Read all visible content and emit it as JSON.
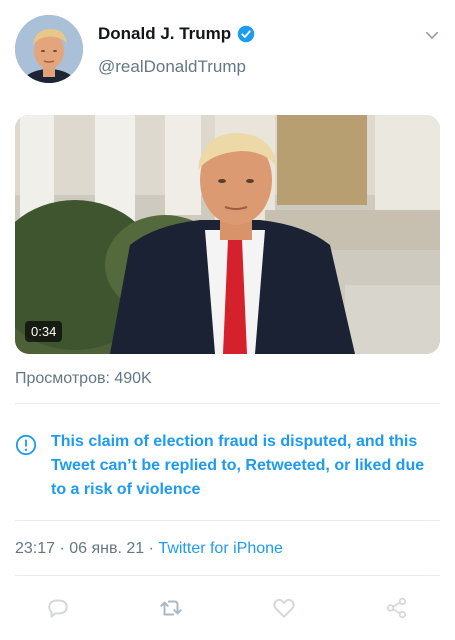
{
  "tweet": {
    "author_name": "Donald J. Trump",
    "author_handle": "@realDonaldTrump",
    "verified": true,
    "video_duration": "0:34",
    "views_text": "Просмотров: 490K",
    "notice_text": "This claim of election fraud is disputed, and this Tweet can’t be replied to, Retweeted, or liked due to a risk of violence",
    "time": "23:17",
    "separator": " · ",
    "date": "06 янв. 21",
    "source": "Twitter for iPhone"
  },
  "icons": {
    "verified": "verified-badge-icon",
    "menu": "chevron-down-icon",
    "notice": "info-icon",
    "reply": "reply-icon",
    "retweet": "retweet-icon",
    "like": "like-icon",
    "share": "share-icon"
  },
  "colors": {
    "accent": "#1d9bf0",
    "secondary_text": "#657786",
    "primary_text": "#14171a",
    "divider": "#e6ecf0"
  }
}
